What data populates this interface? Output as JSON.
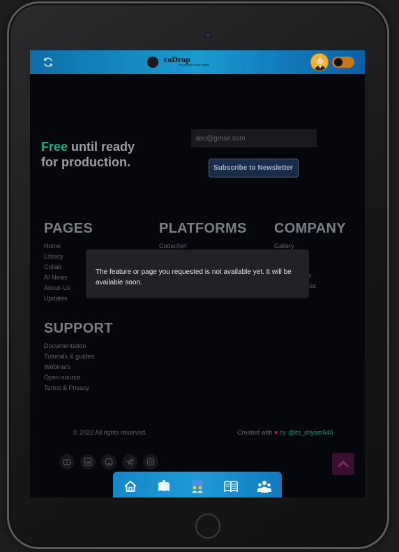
{
  "topbar": {
    "refresh_icon": "refresh-icon",
    "logo_text": "coDrop",
    "logo_tagline": "my portfolio daily folders",
    "avatar_icon": "user-avatar-icon",
    "toggle_state": "dark"
  },
  "hero": {
    "accent_word": "Free",
    "rest_line1": " until ready",
    "line2": "for production.",
    "accent_color": "#17b28a"
  },
  "newsletter": {
    "email_placeholder": "abc@gmail.com",
    "subscribe_label": "Subscribe to Newsletter"
  },
  "footer": {
    "pages": {
      "title": "PAGES",
      "items": [
        "Home",
        "Library",
        "Collab",
        "AI News",
        "About-Us",
        "Updates"
      ]
    },
    "platforms": {
      "title": "PLATFORMS",
      "items": [
        "Codechef"
      ]
    },
    "company": {
      "title": "COMPANY",
      "items": [
        "Gallery",
        "ories",
        "unities"
      ]
    },
    "support": {
      "title": "SUPPORT",
      "items": [
        "Documentation",
        "Tutorials & guides",
        "Webinars",
        "Open-source",
        "Terms & Privacy"
      ]
    },
    "copyright": "© 2022 All rights reserved.",
    "credit_prefix": "Created with",
    "credit_by": "by",
    "credit_handle": "@its_shyam640"
  },
  "toast": {
    "message": "The feature or page you requested is not available yet. It will be available soon."
  },
  "socials": [
    "youtube-icon",
    "linkedin-icon",
    "github-icon",
    "telegram-icon",
    "instagram-icon"
  ],
  "bottom_nav": [
    "home-icon",
    "library-icon",
    "collab-icon",
    "news-icon",
    "community-icon"
  ],
  "colors": {
    "topbar": "#1a9bd0",
    "background": "#05070c",
    "scroll_top": "#3a1030"
  }
}
